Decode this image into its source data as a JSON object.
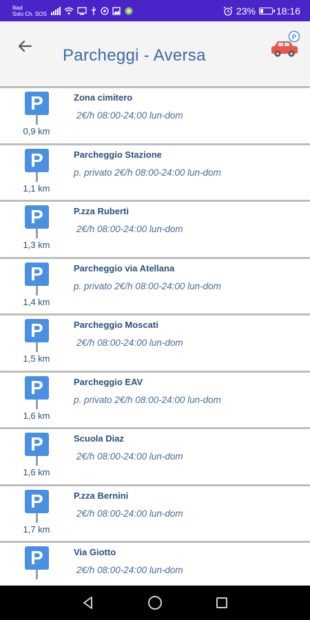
{
  "status_bar": {
    "carrier_line1": "Iliad",
    "carrier_line2": "Solo Ch. SOS",
    "battery": "23%",
    "battery_level": 0.23,
    "time": "18:16"
  },
  "app_bar": {
    "title": "Parcheggi - Aversa"
  },
  "parking_sign_letter": "P",
  "parkings": [
    {
      "name": "Zona cimitero",
      "info": "2€/h 08:00-24:00 lun-dom",
      "distance": "0,9 km",
      "private": false
    },
    {
      "name": "Parcheggio Stazione",
      "info": "p. privato 2€/h 08:00-24:00 lun-dom",
      "distance": "1,1 km",
      "private": true
    },
    {
      "name": "P.zza Ruberti",
      "info": "2€/h 08:00-24:00 lun-dom",
      "distance": "1,3 km",
      "private": false
    },
    {
      "name": "Parcheggio via Atellana",
      "info": "p. privato 2€/h 08:00-24:00 lun-dom",
      "distance": "1,4 km",
      "private": true
    },
    {
      "name": "Parcheggio Moscati",
      "info": "2€/h 08:00-24:00 lun-dom",
      "distance": "1,5 km",
      "private": false
    },
    {
      "name": "Parcheggio EAV",
      "info": "p. privato 2€/h 08:00-24:00 lun-dom",
      "distance": "1,6 km",
      "private": true
    },
    {
      "name": "Scuola Diaz",
      "info": "2€/h 08:00-24:00 lun-dom",
      "distance": "1,6 km",
      "private": false
    },
    {
      "name": "P.zza Bernini",
      "info": "2€/h 08:00-24:00 lun-dom",
      "distance": "1,7 km",
      "private": false
    },
    {
      "name": "Via Giotto",
      "info": "2€/h 08:00-24:00 lun-dom",
      "distance": "",
      "private": false
    }
  ],
  "colors": {
    "status_bar": "#4a24c9",
    "title": "#3c6aa4",
    "parking_sign": "#4a90e2",
    "car": "#e8574a"
  }
}
